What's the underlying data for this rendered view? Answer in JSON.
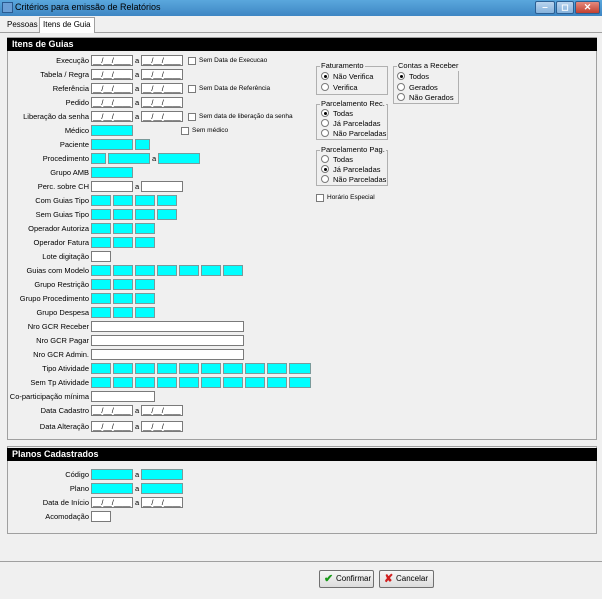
{
  "window": {
    "title": "Critérios para emissão de Relatórios",
    "minimize": "‒",
    "maximize": "◻",
    "close": "✕"
  },
  "tabs": [
    "Pessoas",
    "Itens de Guia"
  ],
  "date_mask": "__/__/____",
  "sections": {
    "itens": "Itens de Guias",
    "planos": "Planos Cadastrados"
  },
  "fields": {
    "execucao": "Execução",
    "tabela": "Tabela / Regra",
    "referencia": "Referência",
    "pedido": "Pedido",
    "liberacao": "Liberação da senha",
    "medico": "Médico",
    "paciente": "Paciente",
    "procedimento": "Procedimento",
    "grupo_amb": "Grupo AMB",
    "perc_ch": "Perc. sobre CH",
    "com_guias_tipo": "Com Guias Tipo",
    "sem_guias_tipo": "Sem Guias Tipo",
    "operador_autoriza": "Operador Autoriza",
    "operador_fatura": "Operador Fatura",
    "lote_digitacao": "Lote digitação",
    "guias_com_modelo": "Guias com Modelo",
    "grupo_restricao": "Grupo Restrição",
    "grupo_procedimento": "Grupo Procedimento",
    "grupo_despesa": "Grupo Despesa",
    "nro_gcr_receber": "Nro GCR Receber",
    "nro_gcr_pagar": "Nro GCR Pagar",
    "nro_gcr_admin": "Nro GCR Admin.",
    "tipo_atividade": "Tipo Atividade",
    "sem_tp_atividade": "Sem Tp Atividade",
    "coparticipacao": "Co-participação mínima",
    "data_cadastro": "Data Cadastro",
    "data_alteracao": "Data Alteração"
  },
  "a": "a",
  "checks": {
    "sem_data_execucao": "Sem Data de Execucao",
    "sem_data_referencia": "Sem Data de Referência",
    "sem_data_liberacao": "Sem data de liberação da senha",
    "sem_medico": "Sem médico",
    "horario_especial": "Horário Especial"
  },
  "faturamento": {
    "title": "Faturamento",
    "options": [
      "Não Verifica",
      "Verifica"
    ]
  },
  "contas": {
    "title": "Contas a Receber",
    "options": [
      "Todos",
      "Gerados",
      "Não Gerados"
    ]
  },
  "parc_rec": {
    "title": "Parcelamento Rec.",
    "options": [
      "Todas",
      "Já Parceladas",
      "Não Parceladas"
    ]
  },
  "parc_pag": {
    "title": "Parcelamento Pag.",
    "options": [
      "Todas",
      "Já Parceladas",
      "Não Parceladas"
    ]
  },
  "planos": {
    "codigo": "Código",
    "plano": "Plano",
    "data_inicio": "Data de Início",
    "acomodacao": "Acomodação"
  },
  "buttons": {
    "confirmar": "Confirmar",
    "cancelar": "Cancelar"
  },
  "colors": {
    "accent": "#00ffff",
    "header": "#000000"
  }
}
